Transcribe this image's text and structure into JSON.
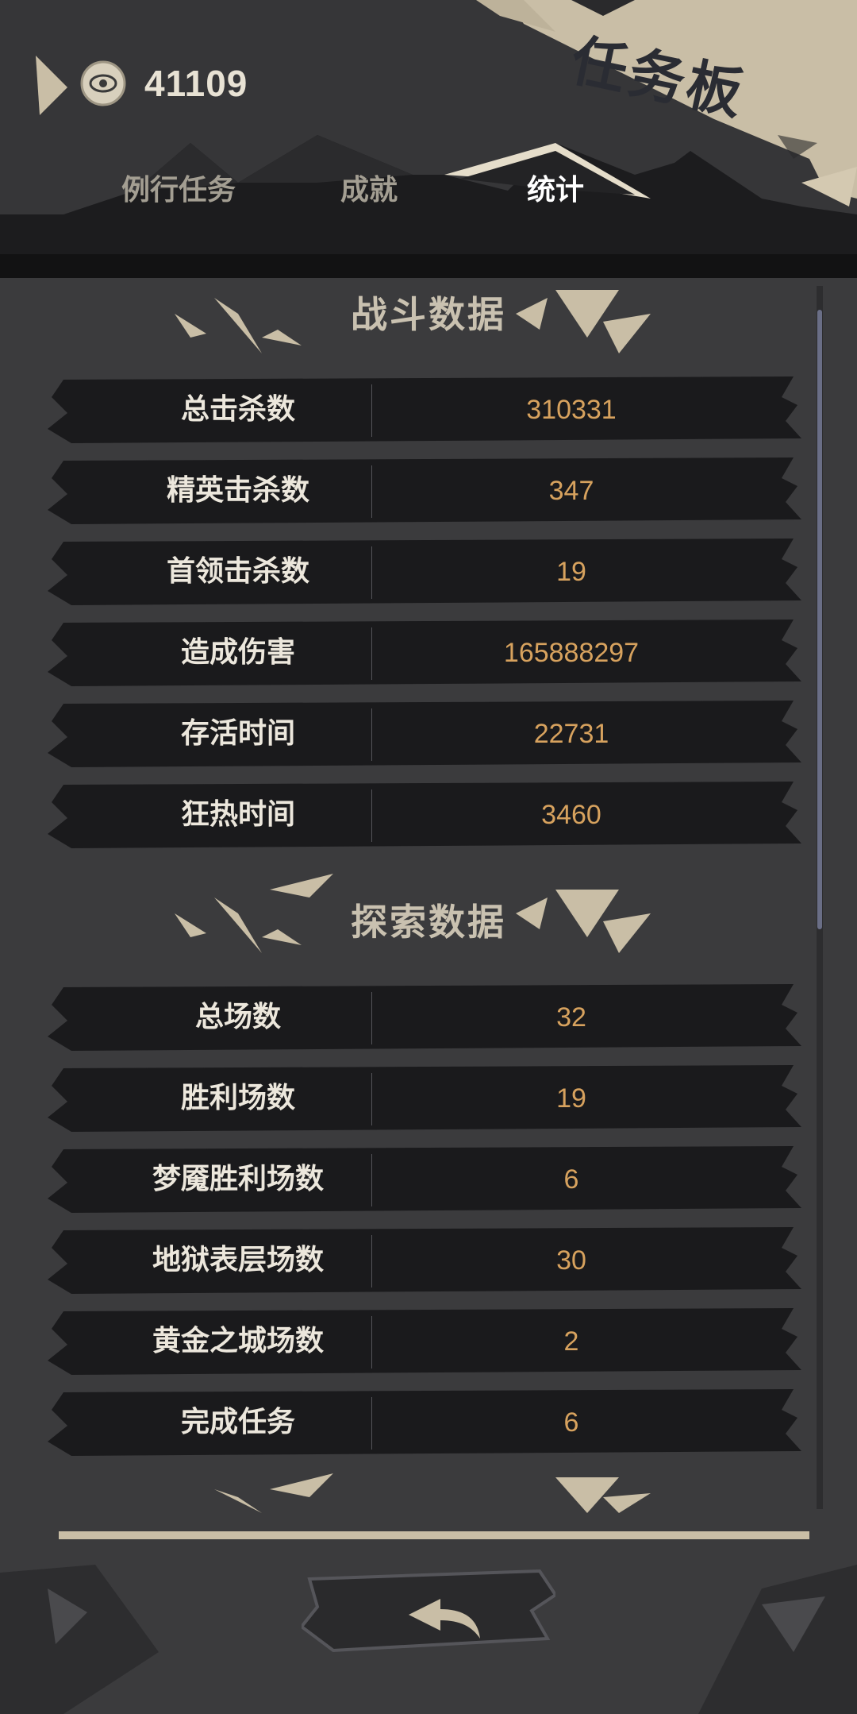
{
  "header": {
    "currency_value": "41109",
    "title": "任务板"
  },
  "tabs": [
    {
      "label": "例行任务",
      "active": false
    },
    {
      "label": "成就",
      "active": false
    },
    {
      "label": "统计",
      "active": true
    }
  ],
  "sections": [
    {
      "title": "战斗数据",
      "rows": [
        {
          "label": "总击杀数",
          "value": "310331"
        },
        {
          "label": "精英击杀数",
          "value": "347"
        },
        {
          "label": "首领击杀数",
          "value": "19"
        },
        {
          "label": "造成伤害",
          "value": "165888297"
        },
        {
          "label": "存活时间",
          "value": "22731"
        },
        {
          "label": "狂热时间",
          "value": "3460"
        }
      ]
    },
    {
      "title": "探索数据",
      "rows": [
        {
          "label": "总场数",
          "value": "32"
        },
        {
          "label": "胜利场数",
          "value": "19"
        },
        {
          "label": "梦魇胜利场数",
          "value": "6"
        },
        {
          "label": "地狱表层场数",
          "value": "30"
        },
        {
          "label": "黄金之城场数",
          "value": "2"
        },
        {
          "label": "完成任务",
          "value": "6"
        }
      ]
    }
  ],
  "icons": {
    "currency": "eye-coin-icon",
    "back": "back-arrow-icon"
  },
  "colors": {
    "background": "#3b3b3d",
    "row_bg": "#1a1a1c",
    "label_text": "#ece7dc",
    "value_text": "#d7a25e",
    "accent_beige": "#c9bea6"
  }
}
